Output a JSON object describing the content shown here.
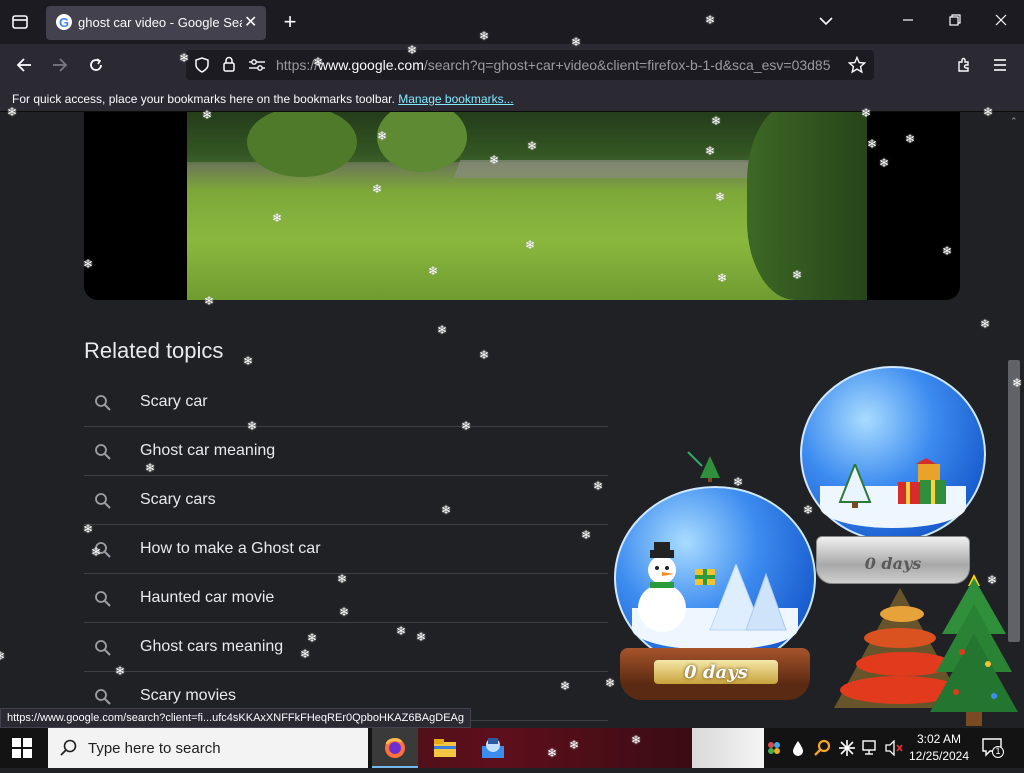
{
  "browser": {
    "tab_title": "ghost car video - Google Search",
    "url_prefix": "https://",
    "url_host": "www.google.com",
    "url_path": "/search?q=ghost+car+video&client=firefox-b-1-d&sca_esv=03d85",
    "bookmarks_message": "For quick access, place your bookmarks here on the bookmarks toolbar.",
    "bookmarks_link": "Manage bookmarks...",
    "status_url": "https://www.google.com/search?client=fi...ufc4sKKAxXNFFkFHeqREr0QpboHKAZ6BAgDEAg"
  },
  "page": {
    "related_title": "Related topics",
    "topics": [
      {
        "label": "Scary car"
      },
      {
        "label": "Ghost car meaning"
      },
      {
        "label": "Scary cars"
      },
      {
        "label": "How to make a Ghost car"
      },
      {
        "label": "Haunted car movie"
      },
      {
        "label": "Ghost cars meaning"
      },
      {
        "label": "Scary movies"
      }
    ]
  },
  "widgets": {
    "globe_small_days": "0 days",
    "globe_large_days": "0 days"
  },
  "taskbar": {
    "search_placeholder": "Type here to search",
    "time": "3:02 AM",
    "date": "12/25/2024",
    "notification_count": "1"
  },
  "colors": {
    "page_bg": "#202124",
    "link": "#80ebff",
    "tab_bg": "#42414d"
  }
}
